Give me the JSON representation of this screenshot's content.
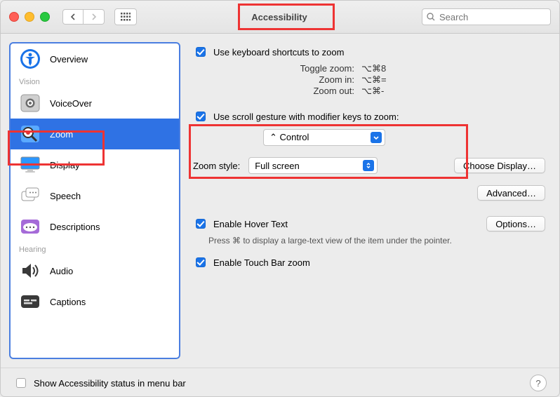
{
  "window": {
    "title": "Accessibility"
  },
  "toolbar": {
    "search_placeholder": "Search"
  },
  "sidebar": {
    "sections": [
      {
        "items": [
          {
            "label": "Overview",
            "icon": "accessibility-icon"
          }
        ]
      },
      {
        "header": "Vision",
        "items": [
          {
            "label": "VoiceOver",
            "icon": "voiceover-icon"
          },
          {
            "label": "Zoom",
            "icon": "zoom-icon",
            "selected": true
          },
          {
            "label": "Display",
            "icon": "display-icon"
          },
          {
            "label": "Speech",
            "icon": "speech-icon"
          },
          {
            "label": "Descriptions",
            "icon": "descriptions-icon"
          }
        ]
      },
      {
        "header": "Hearing",
        "items": [
          {
            "label": "Audio",
            "icon": "audio-icon"
          },
          {
            "label": "Captions",
            "icon": "captions-icon"
          }
        ]
      }
    ]
  },
  "pane": {
    "use_shortcuts": {
      "label": "Use keyboard shortcuts to zoom",
      "checked": true
    },
    "shortcuts": {
      "toggle": {
        "label": "Toggle zoom:",
        "value": "⌥⌘8"
      },
      "in": {
        "label": "Zoom in:",
        "value": "⌥⌘="
      },
      "out": {
        "label": "Zoom out:",
        "value": "⌥⌘-"
      }
    },
    "use_scroll": {
      "label": "Use scroll gesture with modifier keys to zoom:",
      "checked": true
    },
    "modifier_select": {
      "value": "⌃ Control"
    },
    "zoom_style": {
      "label": "Zoom style:",
      "value": "Full screen"
    },
    "choose_display_btn": "Choose Display…",
    "advanced_btn": "Advanced…",
    "hover": {
      "label": "Enable Hover Text",
      "checked": true
    },
    "hover_options_btn": "Options…",
    "hover_hint": "Press ⌘ to display a large-text view of the item under the pointer.",
    "touchbar": {
      "label": "Enable Touch Bar zoom",
      "checked": true
    }
  },
  "footer": {
    "status_label": "Show Accessibility status in menu bar",
    "status_checked": false
  }
}
